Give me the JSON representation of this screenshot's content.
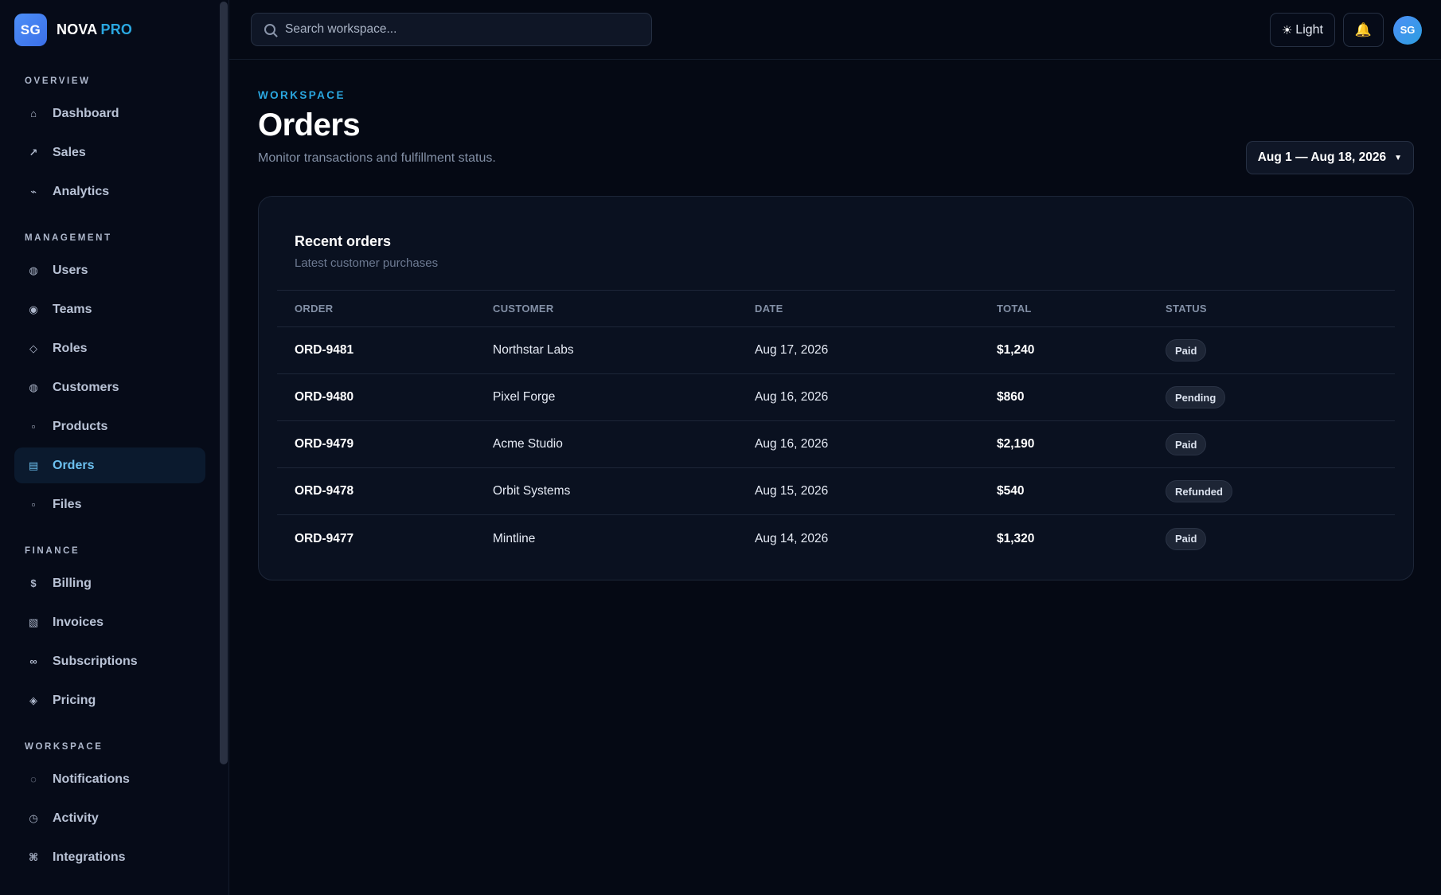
{
  "brand": {
    "logo": "SG",
    "name": "NOVA",
    "suffix": "PRO"
  },
  "sidebar": {
    "sections": [
      {
        "label": "OVERVIEW",
        "items": [
          {
            "label": "Dashboard",
            "icon": "⌂",
            "icon_name": "home-icon"
          },
          {
            "label": "Sales",
            "icon": "↗",
            "icon_name": "trend-up-icon"
          },
          {
            "label": "Analytics",
            "icon": "⌁",
            "icon_name": "analytics-icon"
          }
        ]
      },
      {
        "label": "MANAGEMENT",
        "items": [
          {
            "label": "Users",
            "icon": "◍",
            "icon_name": "users-icon"
          },
          {
            "label": "Teams",
            "icon": "◉",
            "icon_name": "teams-icon"
          },
          {
            "label": "Roles",
            "icon": "◇",
            "icon_name": "roles-icon"
          },
          {
            "label": "Customers",
            "icon": "◍",
            "icon_name": "customers-icon"
          },
          {
            "label": "Products",
            "icon": "▫",
            "icon_name": "products-icon"
          },
          {
            "label": "Orders",
            "icon": "▤",
            "icon_name": "orders-icon",
            "active": true
          },
          {
            "label": "Files",
            "icon": "▫",
            "icon_name": "files-icon"
          }
        ]
      },
      {
        "label": "FINANCE",
        "items": [
          {
            "label": "Billing",
            "icon": "$",
            "icon_name": "billing-icon"
          },
          {
            "label": "Invoices",
            "icon": "▧",
            "icon_name": "invoices-icon"
          },
          {
            "label": "Subscriptions",
            "icon": "∞",
            "icon_name": "subscriptions-icon"
          },
          {
            "label": "Pricing",
            "icon": "◈",
            "icon_name": "pricing-icon"
          }
        ]
      },
      {
        "label": "WORKSPACE",
        "items": [
          {
            "label": "Notifications",
            "icon": "◌",
            "icon_name": "notifications-icon"
          },
          {
            "label": "Activity",
            "icon": "◷",
            "icon_name": "activity-icon"
          },
          {
            "label": "Integrations",
            "icon": "⌘",
            "icon_name": "integrations-icon"
          }
        ]
      }
    ]
  },
  "topbar": {
    "search_placeholder": "Search workspace...",
    "theme_icon": "☀",
    "theme_label": "Light",
    "bell_icon": "🔔",
    "avatar": "SG"
  },
  "page": {
    "eyebrow": "WORKSPACE",
    "title": "Orders",
    "subtitle": "Monitor transactions and fulfillment status.",
    "date_range": "Aug 1 — Aug 18, 2026",
    "date_caret": "▼"
  },
  "card": {
    "title": "Recent orders",
    "subtitle": "Latest customer purchases",
    "columns": {
      "order": "ORDER",
      "customer": "CUSTOMER",
      "date": "DATE",
      "total": "TOTAL",
      "status": "STATUS"
    },
    "rows": [
      {
        "order": "ORD-9481",
        "customer": "Northstar Labs",
        "date": "Aug 17, 2026",
        "total": "$1,240",
        "status": "Paid"
      },
      {
        "order": "ORD-9480",
        "customer": "Pixel Forge",
        "date": "Aug 16, 2026",
        "total": "$860",
        "status": "Pending"
      },
      {
        "order": "ORD-9479",
        "customer": "Acme Studio",
        "date": "Aug 16, 2026",
        "total": "$2,190",
        "status": "Paid"
      },
      {
        "order": "ORD-9478",
        "customer": "Orbit Systems",
        "date": "Aug 15, 2026",
        "total": "$540",
        "status": "Refunded"
      },
      {
        "order": "ORD-9477",
        "customer": "Mintline",
        "date": "Aug 14, 2026",
        "total": "$1,320",
        "status": "Paid"
      }
    ]
  },
  "colors": {
    "background": "#050914",
    "accent": "#2aa7e0",
    "active_nav_bg": "#0b1a2e",
    "active_nav_text": "#6cc0ef",
    "bell": "#f3b520"
  }
}
